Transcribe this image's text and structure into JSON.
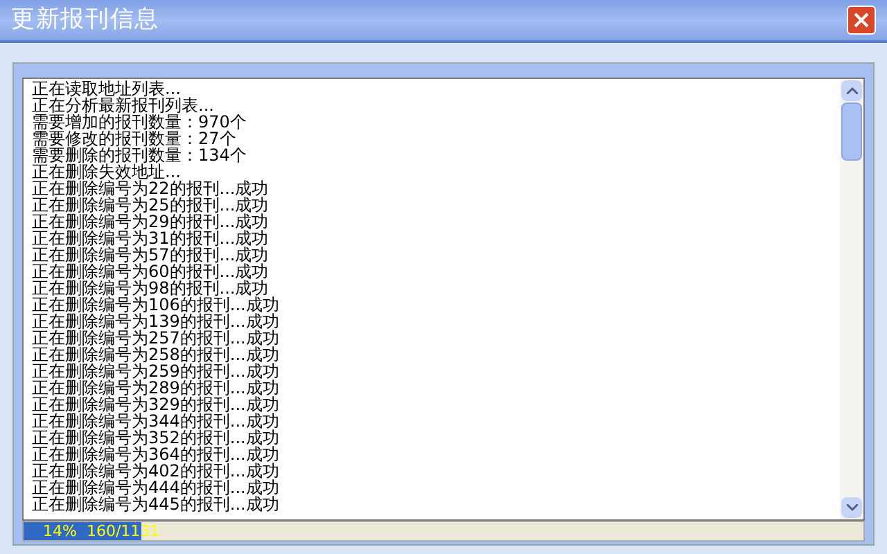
{
  "window": {
    "title": "更新报刊信息"
  },
  "log": {
    "lines": [
      "正在读取地址列表...",
      "正在分析最新报刊列表...",
      "需要增加的报刊数量：970个",
      "需要修改的报刊数量：27个",
      "需要删除的报刊数量：134个",
      "正在删除失效地址...",
      "正在删除编号为22的报刊...成功",
      "正在删除编号为25的报刊...成功",
      "正在删除编号为29的报刊...成功",
      "正在删除编号为31的报刊...成功",
      "正在删除编号为57的报刊...成功",
      "正在删除编号为60的报刊...成功",
      "正在删除编号为98的报刊...成功",
      "正在删除编号为106的报刊...成功",
      "正在删除编号为139的报刊...成功",
      "正在删除编号为257的报刊...成功",
      "正在删除编号为258的报刊...成功",
      "正在删除编号为259的报刊...成功",
      "正在删除编号为289的报刊...成功",
      "正在删除编号为329的报刊...成功",
      "正在删除编号为344的报刊...成功",
      "正在删除编号为352的报刊...成功",
      "正在删除编号为364的报刊...成功",
      "正在删除编号为402的报刊...成功",
      "正在删除编号为444的报刊...成功",
      "正在删除编号为445的报刊...成功"
    ]
  },
  "progress": {
    "level": 0.14,
    "text": "14%  160/1131"
  }
}
